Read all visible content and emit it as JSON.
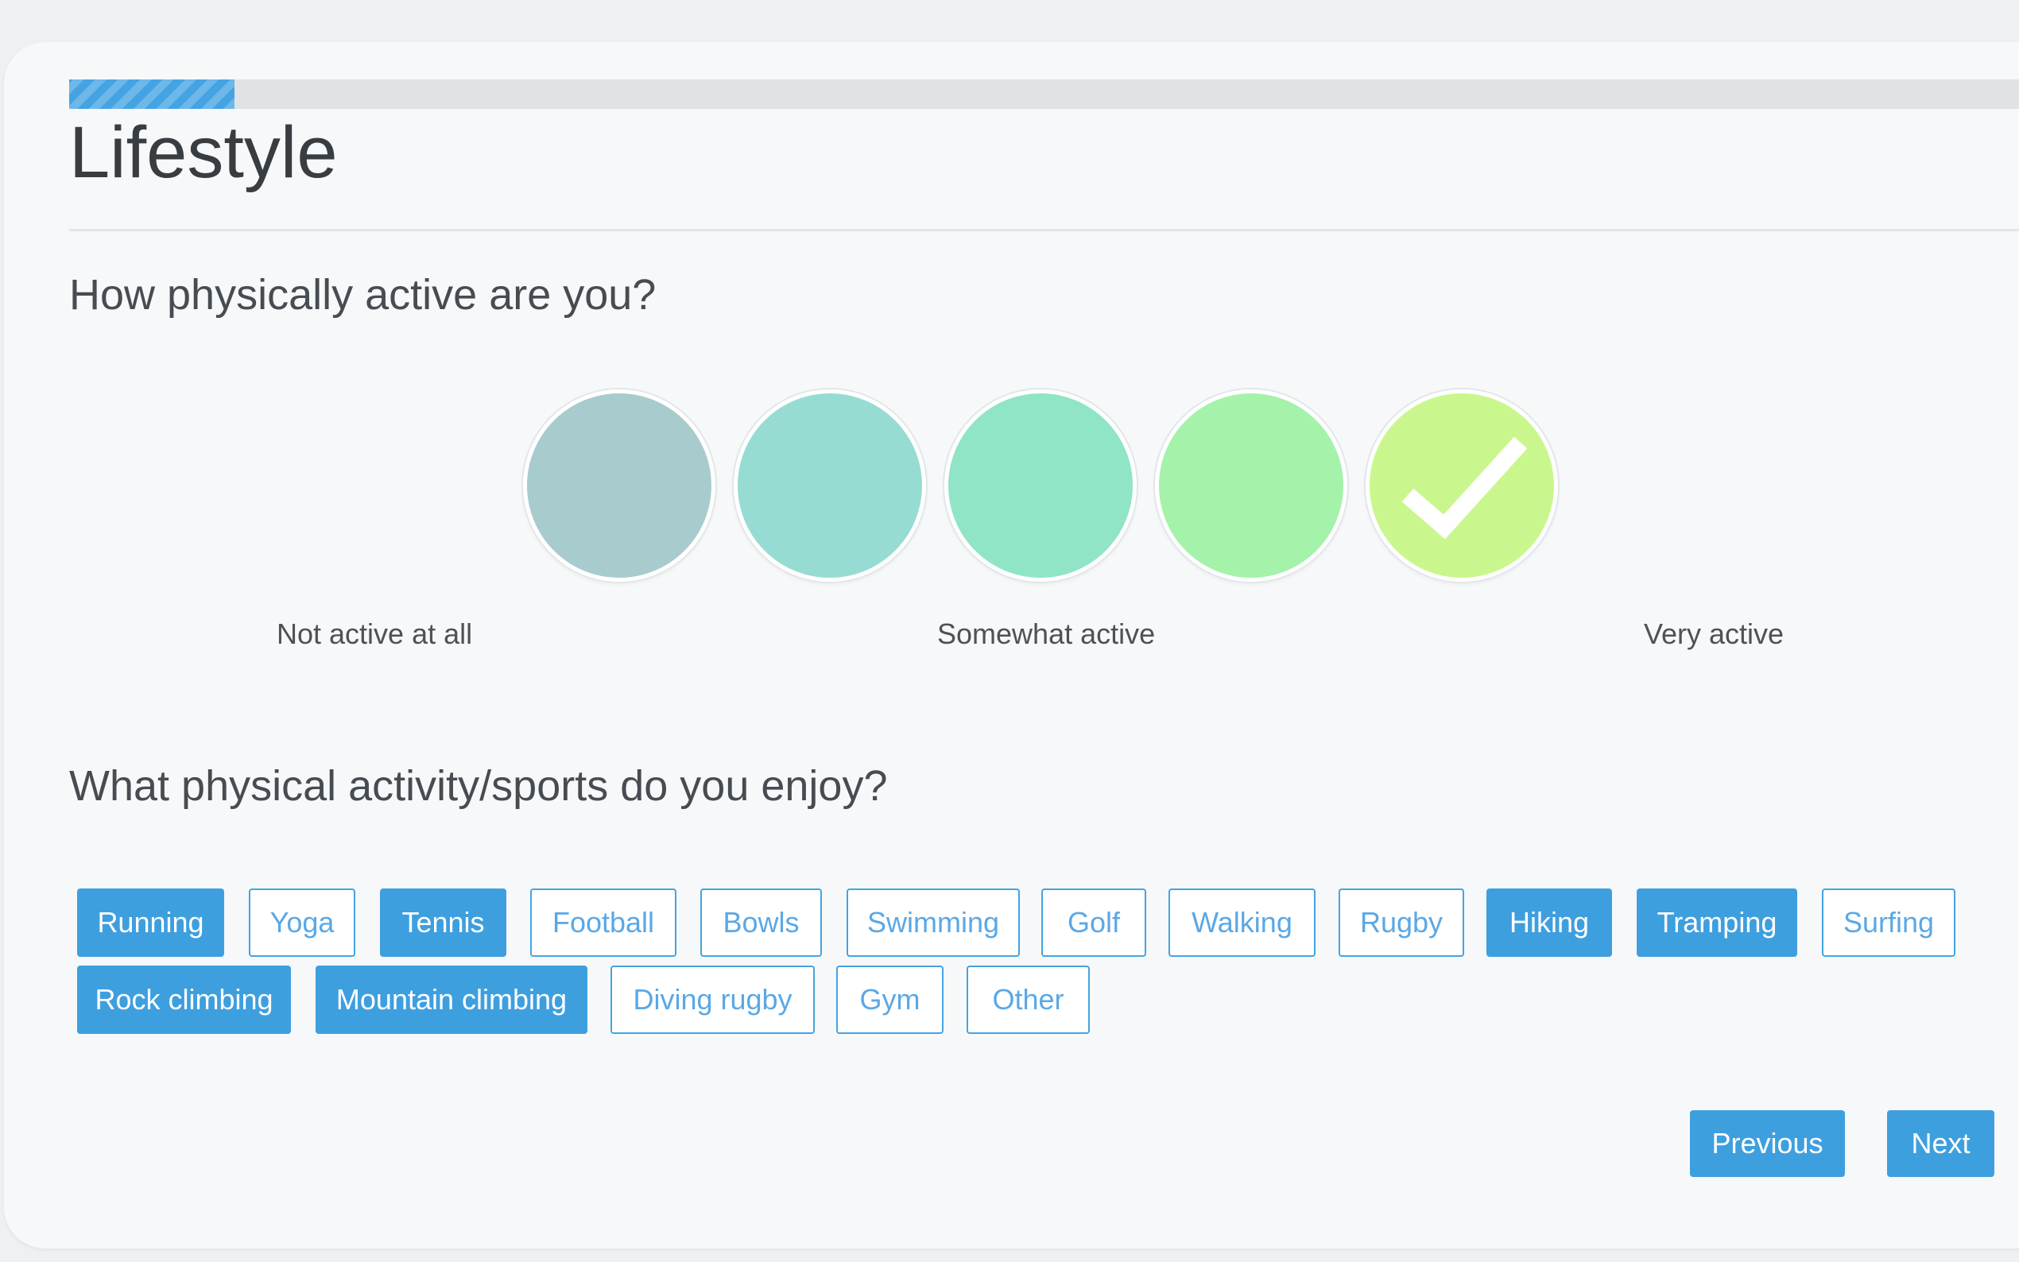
{
  "progress": {
    "fraction": 0.083,
    "color": "#44a3e3"
  },
  "page": {
    "title": "Lifestyle"
  },
  "activity_question": {
    "text": "How physically active are you?",
    "options": [
      {
        "color": "#a8cbce",
        "selected": false
      },
      {
        "color": "#97dcd3",
        "selected": false
      },
      {
        "color": "#8fe5c5",
        "selected": false
      },
      {
        "color": "#a5f2ab",
        "selected": false
      },
      {
        "color": "#c9f78e",
        "selected": true,
        "icon": "check-icon"
      }
    ],
    "labels": {
      "low": "Not active at all",
      "mid": "Somewhat active",
      "high": "Very active"
    }
  },
  "sports_question": {
    "text": "What physical activity/sports do you enjoy?",
    "tags": [
      {
        "label": "Running",
        "selected": true
      },
      {
        "label": "Yoga",
        "selected": false
      },
      {
        "label": "Tennis",
        "selected": true
      },
      {
        "label": "Football",
        "selected": false
      },
      {
        "label": "Bowls",
        "selected": false
      },
      {
        "label": "Swimming",
        "selected": false
      },
      {
        "label": "Golf",
        "selected": false
      },
      {
        "label": "Walking",
        "selected": false
      },
      {
        "label": "Rugby",
        "selected": false
      },
      {
        "label": "Hiking",
        "selected": true
      },
      {
        "label": "Tramping",
        "selected": true
      },
      {
        "label": "Surfing",
        "selected": false
      },
      {
        "label": "Rock climbing",
        "selected": true
      },
      {
        "label": "Mountain climbing",
        "selected": true
      },
      {
        "label": "Diving rugby",
        "selected": false
      },
      {
        "label": "Gym",
        "selected": false
      },
      {
        "label": "Other",
        "selected": false
      }
    ]
  },
  "nav": {
    "previous_label": "Previous",
    "next_label": "Next"
  },
  "colors": {
    "accent": "#3e9fdf",
    "card_background": "#f6f8f9"
  }
}
